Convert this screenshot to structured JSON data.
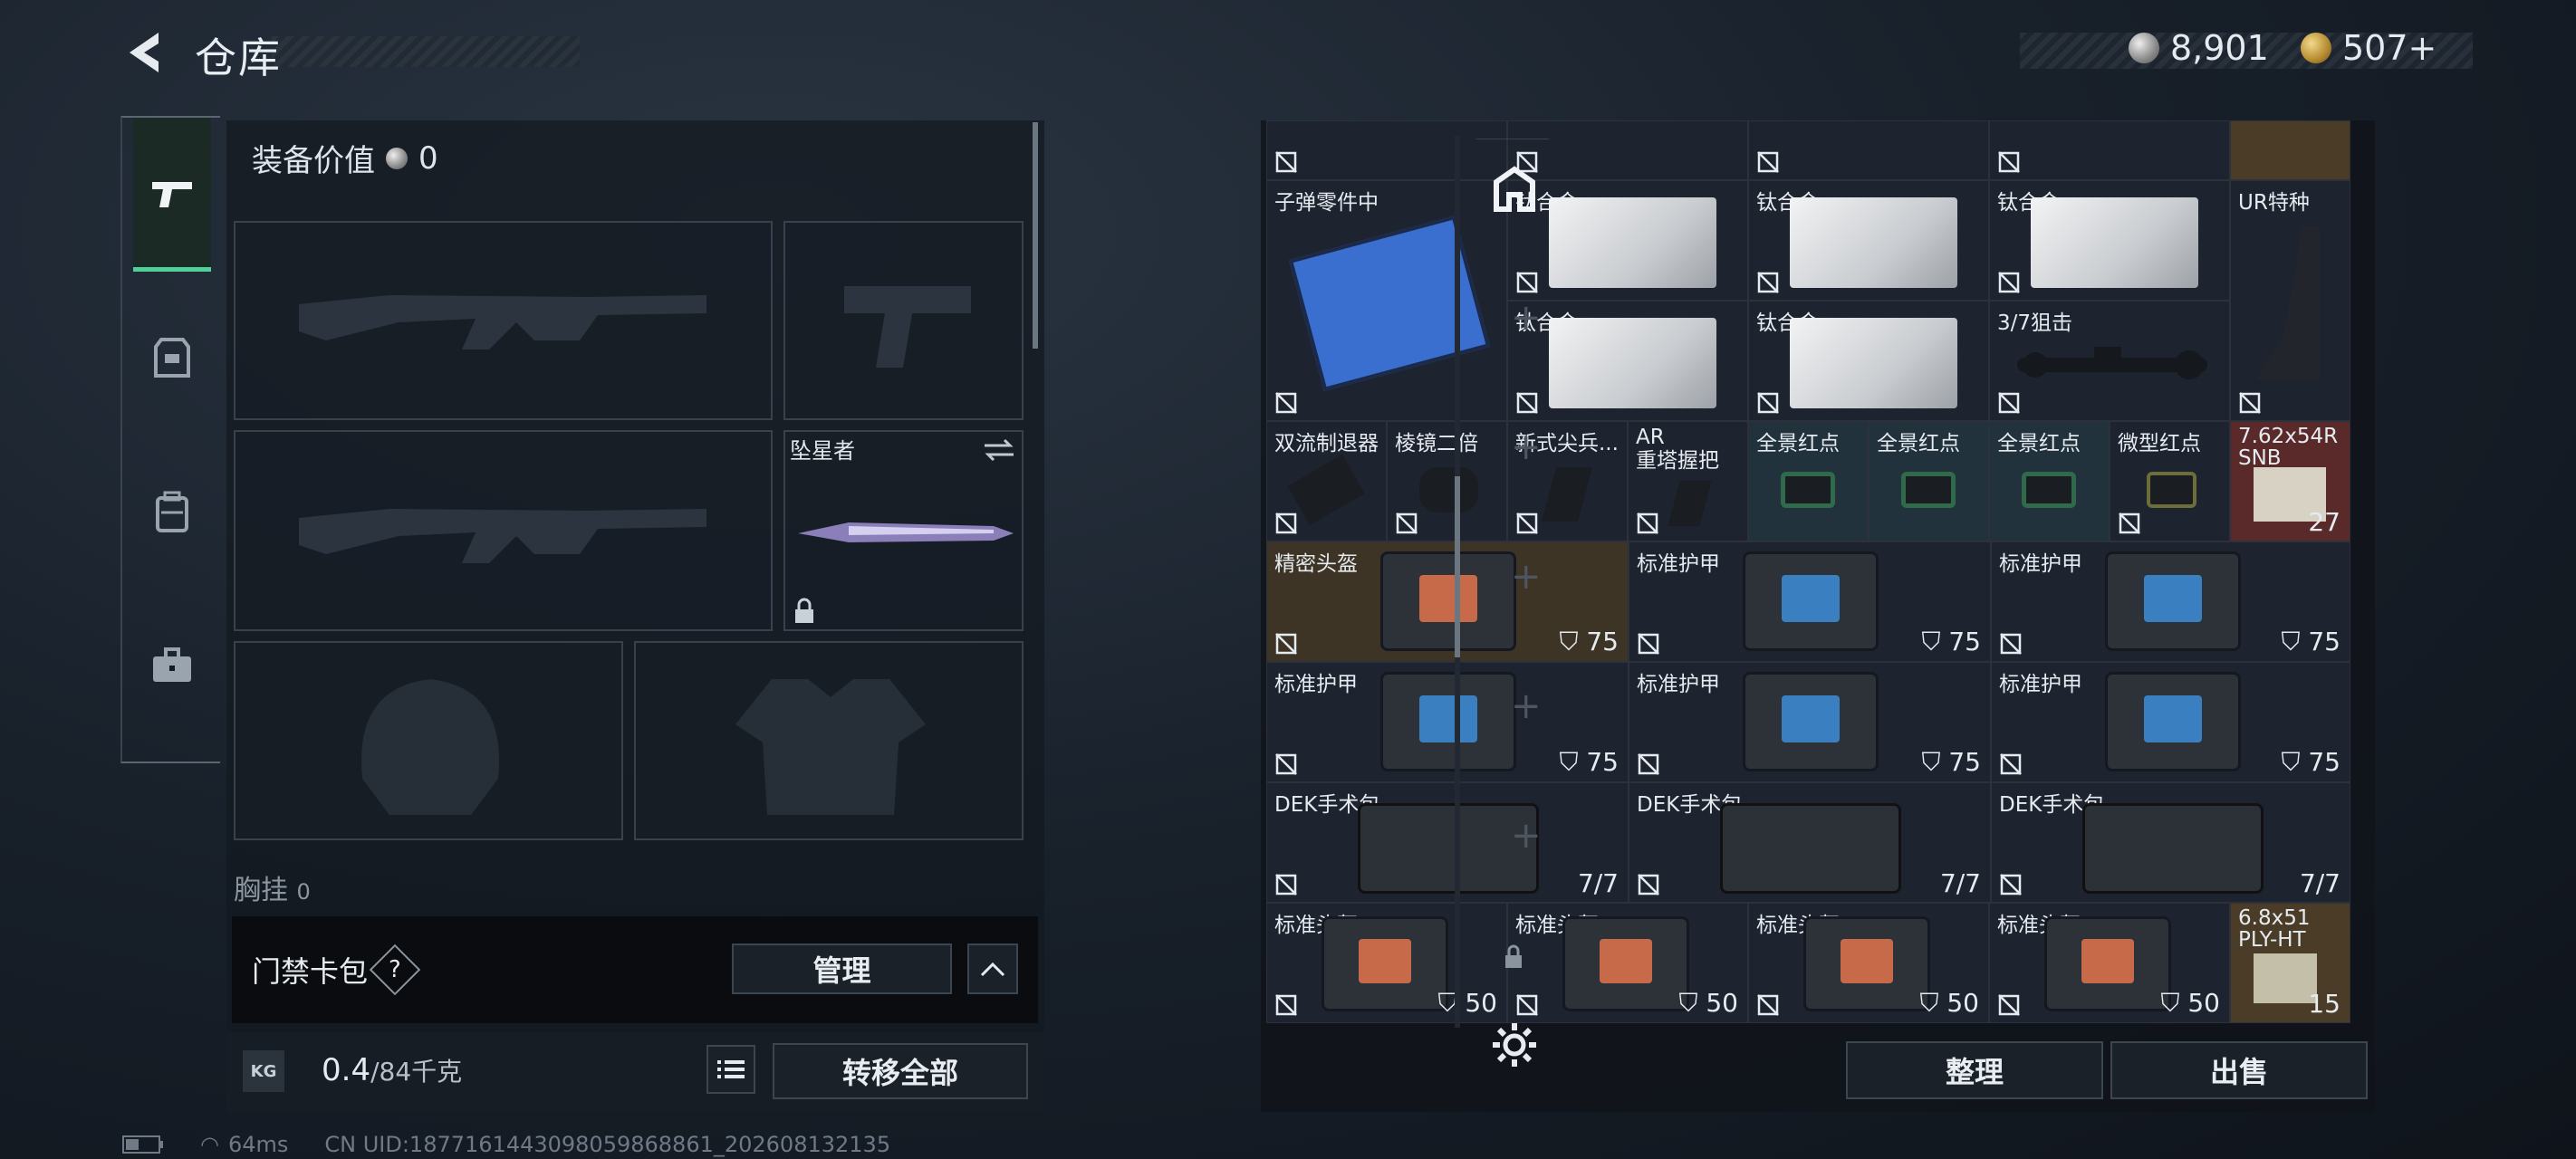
{
  "header": {
    "title": "仓库"
  },
  "currency": {
    "silver": "8,901",
    "gold": "507+"
  },
  "left": {
    "equip_value_label": "装备价值",
    "equip_value": "0",
    "melee_name": "坠星者",
    "chest_label": "胸挂",
    "chest_count": "0",
    "key_pack_label": "门禁卡包",
    "help": "?",
    "manage_label": "管理",
    "weight_value": "0.4",
    "weight_cap": "/84千克",
    "kg_icon": "KG",
    "transfer_all_label": "转移全部"
  },
  "status": {
    "ping": "64ms",
    "uid": "CN UID:1877161443098059868861_202608132135"
  },
  "grid": {
    "row0": [
      "",
      "",
      "",
      ""
    ],
    "bullet_parts": "子弹零件中",
    "ti_alloy": "钛合金",
    "ur_special": "UR特种",
    "scope_37": "3/7狙击",
    "items_small": [
      "双流制退器",
      "棱镜二倍",
      "新式尖兵...",
      "AR\n重塔握把",
      "全景红点",
      "全景红点",
      "全景红点",
      "微型红点"
    ],
    "ammo_762": "7.62x54R SNB",
    "ammo_762_count": "27",
    "helmet_precise": "精密头盔",
    "armor_std": "标准护甲",
    "durability_75": "75",
    "dek_kit": "DEK手术包",
    "dek_uses": "7/7",
    "helmet_std": "标准头盔",
    "durability_50": "50",
    "ammo_68": "6.8x51 PLY-HT",
    "ammo_68_count": "15"
  },
  "right": {
    "sort_label": "整理",
    "sell_label": "出售"
  },
  "colors": {
    "accent": "#4fd19a",
    "panel": "#1e2330"
  }
}
